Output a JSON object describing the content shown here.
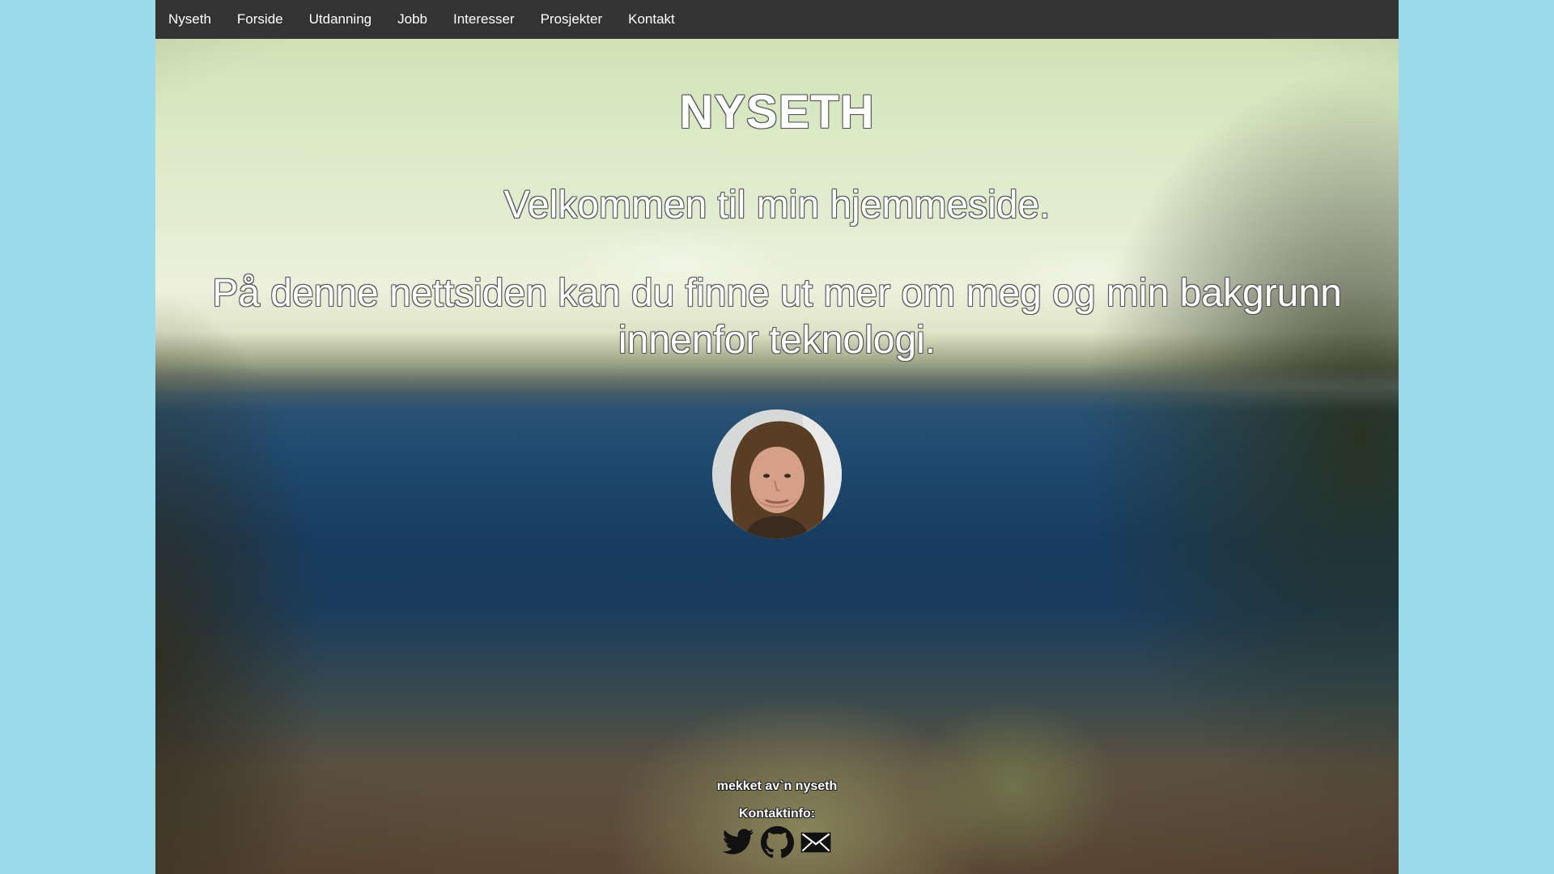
{
  "navbar": {
    "brand": "Nyseth",
    "links": [
      "Forside",
      "Utdanning",
      "Jobb",
      "Interesser",
      "Prosjekter",
      "Kontakt"
    ]
  },
  "main": {
    "title": "NYSETH",
    "welcome": "Velkommen til min hjemmeside.",
    "intro": "På denne nettsiden kan du finne ut mer om meg og min bakgrunn innenfor teknologi."
  },
  "footer": {
    "made_by": "mekket av`n nyseth",
    "contact_label": "Kontaktinfo:",
    "icons": [
      "twitter-icon",
      "github-icon",
      "email-icon"
    ]
  },
  "colors": {
    "page_background": "#99daec",
    "navbar_background": "#333333",
    "nav_text": "#ffffff"
  }
}
